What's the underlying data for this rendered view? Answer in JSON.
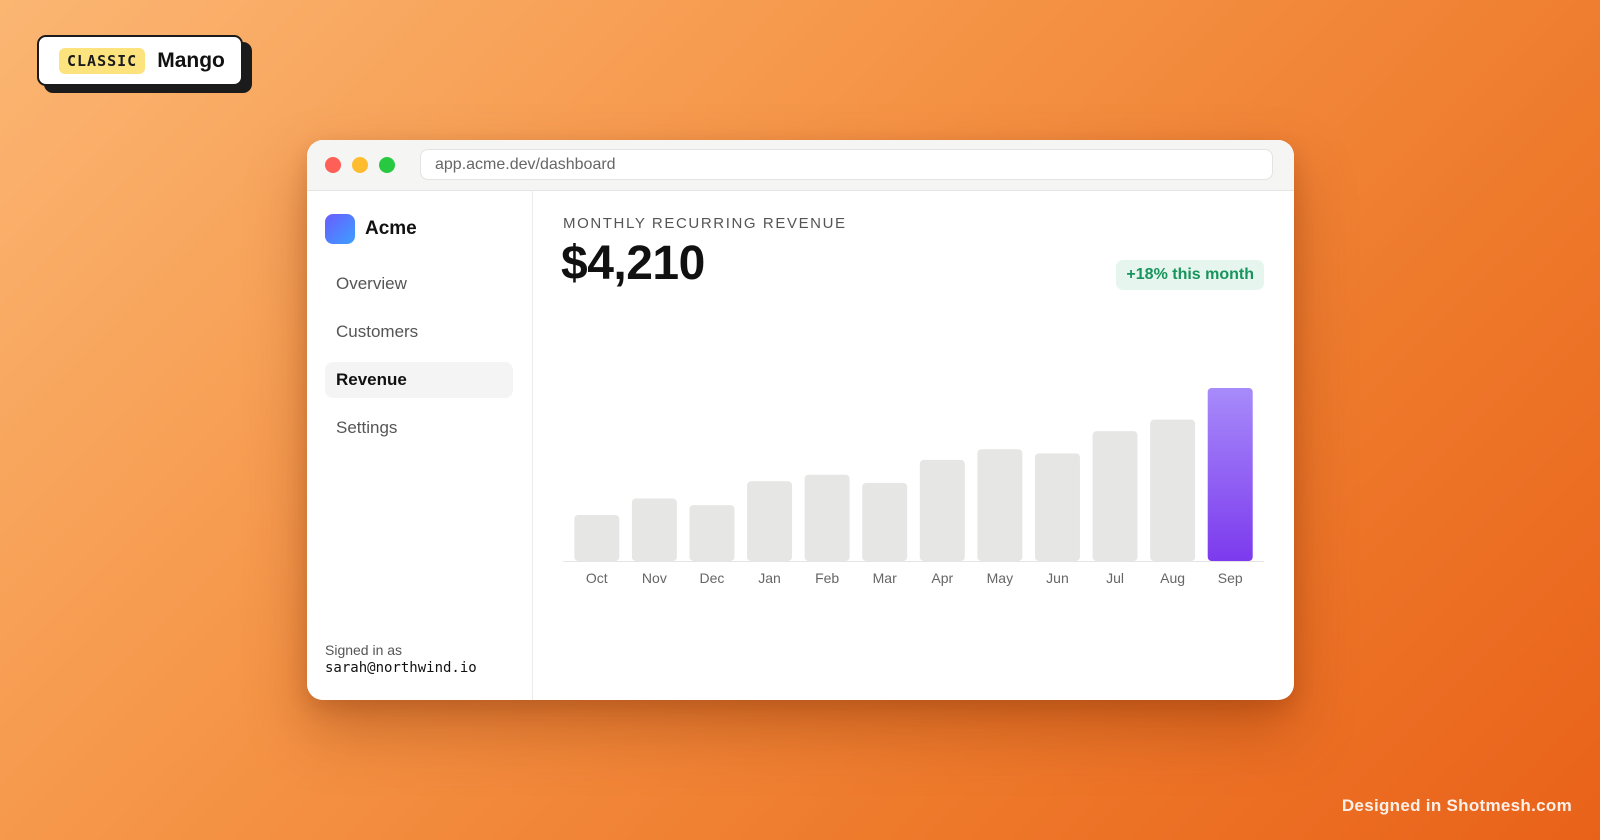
{
  "badge": {
    "tag": "CLASSIC",
    "name": "Mango"
  },
  "window": {
    "url": "app.acme.dev/dashboard"
  },
  "sidebar": {
    "brand": "Acme",
    "items": [
      {
        "label": "Overview",
        "active": false
      },
      {
        "label": "Customers",
        "active": false
      },
      {
        "label": "Revenue",
        "active": true
      },
      {
        "label": "Settings",
        "active": false
      }
    ],
    "signed_in_label": "Signed in as",
    "signed_in_email": "sarah@northwind.io"
  },
  "main": {
    "metric_label": "MONTHLY RECURRING REVENUE",
    "metric_value": "$4,210",
    "delta": "+18% this month"
  },
  "chart_data": {
    "type": "bar",
    "categories": [
      "Oct",
      "Nov",
      "Dec",
      "Jan",
      "Feb",
      "Mar",
      "Apr",
      "May",
      "Jun",
      "Jul",
      "Aug",
      "Sep"
    ],
    "values": [
      1120,
      1520,
      1360,
      1940,
      2100,
      1900,
      2460,
      2720,
      2620,
      3160,
      3440,
      4210
    ],
    "highlight_index": 11,
    "colors": {
      "bar": "#e6e6e4",
      "highlight_top": "#a78bfa",
      "highlight_bottom": "#7c3aed",
      "axis": "#e5e5e5",
      "tick_label": "#666666"
    },
    "ylim": [
      0,
      4210
    ],
    "title": "",
    "xlabel": "",
    "ylabel": ""
  },
  "footer": {
    "credit": "Designed in Shotmesh.com"
  }
}
